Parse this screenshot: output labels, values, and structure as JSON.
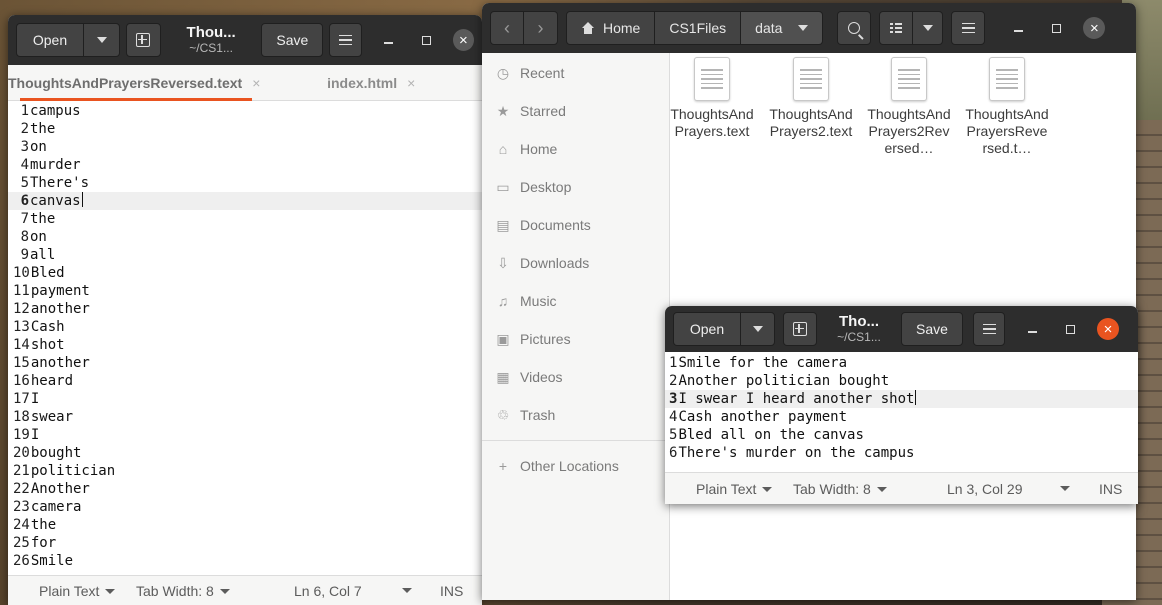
{
  "gedit_main": {
    "open_label": "Open",
    "title": "Thou...",
    "subtitle": "~/CS1...",
    "save_label": "Save",
    "tabs": [
      {
        "label": "ThoughtsAndPrayersReversed.text",
        "close": "×"
      },
      {
        "label": "index.html",
        "close": "×"
      }
    ],
    "lines": [
      {
        "n": "1",
        "text": "campus"
      },
      {
        "n": "2",
        "text": "the"
      },
      {
        "n": "3",
        "text": "on"
      },
      {
        "n": "4",
        "text": "murder"
      },
      {
        "n": "5",
        "text": "There's"
      },
      {
        "n": "6",
        "text": "canvas"
      },
      {
        "n": "7",
        "text": "the"
      },
      {
        "n": "8",
        "text": "on"
      },
      {
        "n": "9",
        "text": "all"
      },
      {
        "n": "10",
        "text": "Bled"
      },
      {
        "n": "11",
        "text": "payment"
      },
      {
        "n": "12",
        "text": "another"
      },
      {
        "n": "13",
        "text": "Cash"
      },
      {
        "n": "14",
        "text": "shot"
      },
      {
        "n": "15",
        "text": "another"
      },
      {
        "n": "16",
        "text": "heard"
      },
      {
        "n": "17",
        "text": "I"
      },
      {
        "n": "18",
        "text": "swear"
      },
      {
        "n": "19",
        "text": "I"
      },
      {
        "n": "20",
        "text": "bought"
      },
      {
        "n": "21",
        "text": "politician"
      },
      {
        "n": "22",
        "text": "Another"
      },
      {
        "n": "23",
        "text": "camera"
      },
      {
        "n": "24",
        "text": "the"
      },
      {
        "n": "25",
        "text": "for"
      },
      {
        "n": "26",
        "text": "Smile"
      }
    ],
    "current_line": "6",
    "status": {
      "language": "Plain Text",
      "tab_width": "Tab Width: 8",
      "position": "Ln 6, Col 7",
      "mode": "INS"
    }
  },
  "files": {
    "crumbs": [
      "Home",
      "CS1Files",
      "data"
    ],
    "sidebar": [
      {
        "label": "Recent",
        "icon": "clock-icon",
        "glyph": "◷"
      },
      {
        "label": "Starred",
        "icon": "star-icon",
        "glyph": "★"
      },
      {
        "label": "Home",
        "icon": "home-icon",
        "glyph": "⌂"
      },
      {
        "label": "Desktop",
        "icon": "desktop-icon",
        "glyph": "▭"
      },
      {
        "label": "Documents",
        "icon": "documents-icon",
        "glyph": "▤"
      },
      {
        "label": "Downloads",
        "icon": "download-icon",
        "glyph": "⇩"
      },
      {
        "label": "Music",
        "icon": "music-icon",
        "glyph": "♫"
      },
      {
        "label": "Pictures",
        "icon": "pictures-icon",
        "glyph": "▣"
      },
      {
        "label": "Videos",
        "icon": "videos-icon",
        "glyph": "▦"
      },
      {
        "label": "Trash",
        "icon": "trash-icon",
        "glyph": "♲"
      }
    ],
    "other_locations": {
      "label": "Other Locations",
      "glyph": "+"
    },
    "items": [
      {
        "name": "ThoughtsAndPrayers.text"
      },
      {
        "name": "ThoughtsAndPrayers2.text"
      },
      {
        "name": "ThoughtsAndPrayers2Reversed…"
      },
      {
        "name": "ThoughtsAndPrayersReversed.t…"
      }
    ]
  },
  "gedit_small": {
    "open_label": "Open",
    "title": "Tho...",
    "subtitle": "~/CS1...",
    "save_label": "Save",
    "lines": [
      {
        "n": "1",
        "text": "Smile for the camera"
      },
      {
        "n": "2",
        "text": "Another politician bought"
      },
      {
        "n": "3",
        "text": "I swear I heard another shot"
      },
      {
        "n": "4",
        "text": "Cash another payment"
      },
      {
        "n": "5",
        "text": "Bled all on the canvas"
      },
      {
        "n": "6",
        "text": "There's murder on the campus"
      }
    ],
    "current_line": "3",
    "status": {
      "language": "Plain Text",
      "tab_width": "Tab Width: 8",
      "position": "Ln 3, Col 29",
      "mode": "INS"
    }
  },
  "colors": {
    "accent": "#e95420",
    "headerbar": "#2d2d2d"
  }
}
